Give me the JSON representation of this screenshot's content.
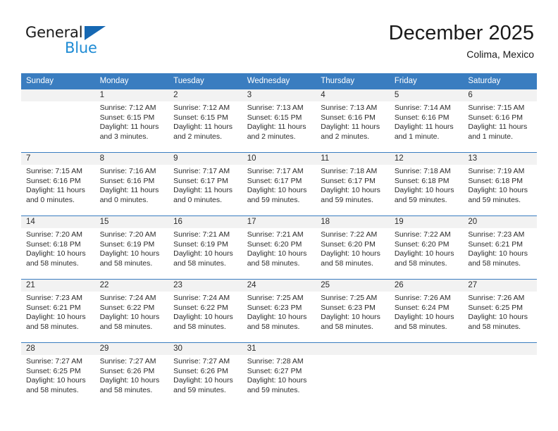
{
  "brand": {
    "name_part1": "General",
    "name_part2": "Blue",
    "triangle_color": "#1668b3",
    "blue_color": "#1e8bd4"
  },
  "header": {
    "title": "December 2025",
    "subtitle": "Colima, Mexico"
  },
  "theme": {
    "header_bar_color": "#3a7dc0",
    "daynum_bg": "#f2f2f2",
    "text_color": "#2b2b2b"
  },
  "weekdays": [
    "Sunday",
    "Monday",
    "Tuesday",
    "Wednesday",
    "Thursday",
    "Friday",
    "Saturday"
  ],
  "weeks": [
    [
      {
        "day": "",
        "sunrise": "",
        "sunset": "",
        "daylight": "",
        "empty": true
      },
      {
        "day": "1",
        "sunrise": "Sunrise: 7:12 AM",
        "sunset": "Sunset: 6:15 PM",
        "daylight": "Daylight: 11 hours and 3 minutes."
      },
      {
        "day": "2",
        "sunrise": "Sunrise: 7:12 AM",
        "sunset": "Sunset: 6:15 PM",
        "daylight": "Daylight: 11 hours and 2 minutes."
      },
      {
        "day": "3",
        "sunrise": "Sunrise: 7:13 AM",
        "sunset": "Sunset: 6:15 PM",
        "daylight": "Daylight: 11 hours and 2 minutes."
      },
      {
        "day": "4",
        "sunrise": "Sunrise: 7:13 AM",
        "sunset": "Sunset: 6:16 PM",
        "daylight": "Daylight: 11 hours and 2 minutes."
      },
      {
        "day": "5",
        "sunrise": "Sunrise: 7:14 AM",
        "sunset": "Sunset: 6:16 PM",
        "daylight": "Daylight: 11 hours and 1 minute."
      },
      {
        "day": "6",
        "sunrise": "Sunrise: 7:15 AM",
        "sunset": "Sunset: 6:16 PM",
        "daylight": "Daylight: 11 hours and 1 minute."
      }
    ],
    [
      {
        "day": "7",
        "sunrise": "Sunrise: 7:15 AM",
        "sunset": "Sunset: 6:16 PM",
        "daylight": "Daylight: 11 hours and 0 minutes."
      },
      {
        "day": "8",
        "sunrise": "Sunrise: 7:16 AM",
        "sunset": "Sunset: 6:16 PM",
        "daylight": "Daylight: 11 hours and 0 minutes."
      },
      {
        "day": "9",
        "sunrise": "Sunrise: 7:17 AM",
        "sunset": "Sunset: 6:17 PM",
        "daylight": "Daylight: 11 hours and 0 minutes."
      },
      {
        "day": "10",
        "sunrise": "Sunrise: 7:17 AM",
        "sunset": "Sunset: 6:17 PM",
        "daylight": "Daylight: 10 hours and 59 minutes."
      },
      {
        "day": "11",
        "sunrise": "Sunrise: 7:18 AM",
        "sunset": "Sunset: 6:17 PM",
        "daylight": "Daylight: 10 hours and 59 minutes."
      },
      {
        "day": "12",
        "sunrise": "Sunrise: 7:18 AM",
        "sunset": "Sunset: 6:18 PM",
        "daylight": "Daylight: 10 hours and 59 minutes."
      },
      {
        "day": "13",
        "sunrise": "Sunrise: 7:19 AM",
        "sunset": "Sunset: 6:18 PM",
        "daylight": "Daylight: 10 hours and 59 minutes."
      }
    ],
    [
      {
        "day": "14",
        "sunrise": "Sunrise: 7:20 AM",
        "sunset": "Sunset: 6:18 PM",
        "daylight": "Daylight: 10 hours and 58 minutes."
      },
      {
        "day": "15",
        "sunrise": "Sunrise: 7:20 AM",
        "sunset": "Sunset: 6:19 PM",
        "daylight": "Daylight: 10 hours and 58 minutes."
      },
      {
        "day": "16",
        "sunrise": "Sunrise: 7:21 AM",
        "sunset": "Sunset: 6:19 PM",
        "daylight": "Daylight: 10 hours and 58 minutes."
      },
      {
        "day": "17",
        "sunrise": "Sunrise: 7:21 AM",
        "sunset": "Sunset: 6:20 PM",
        "daylight": "Daylight: 10 hours and 58 minutes."
      },
      {
        "day": "18",
        "sunrise": "Sunrise: 7:22 AM",
        "sunset": "Sunset: 6:20 PM",
        "daylight": "Daylight: 10 hours and 58 minutes."
      },
      {
        "day": "19",
        "sunrise": "Sunrise: 7:22 AM",
        "sunset": "Sunset: 6:20 PM",
        "daylight": "Daylight: 10 hours and 58 minutes."
      },
      {
        "day": "20",
        "sunrise": "Sunrise: 7:23 AM",
        "sunset": "Sunset: 6:21 PM",
        "daylight": "Daylight: 10 hours and 58 minutes."
      }
    ],
    [
      {
        "day": "21",
        "sunrise": "Sunrise: 7:23 AM",
        "sunset": "Sunset: 6:21 PM",
        "daylight": "Daylight: 10 hours and 58 minutes."
      },
      {
        "day": "22",
        "sunrise": "Sunrise: 7:24 AM",
        "sunset": "Sunset: 6:22 PM",
        "daylight": "Daylight: 10 hours and 58 minutes."
      },
      {
        "day": "23",
        "sunrise": "Sunrise: 7:24 AM",
        "sunset": "Sunset: 6:22 PM",
        "daylight": "Daylight: 10 hours and 58 minutes."
      },
      {
        "day": "24",
        "sunrise": "Sunrise: 7:25 AM",
        "sunset": "Sunset: 6:23 PM",
        "daylight": "Daylight: 10 hours and 58 minutes."
      },
      {
        "day": "25",
        "sunrise": "Sunrise: 7:25 AM",
        "sunset": "Sunset: 6:23 PM",
        "daylight": "Daylight: 10 hours and 58 minutes."
      },
      {
        "day": "26",
        "sunrise": "Sunrise: 7:26 AM",
        "sunset": "Sunset: 6:24 PM",
        "daylight": "Daylight: 10 hours and 58 minutes."
      },
      {
        "day": "27",
        "sunrise": "Sunrise: 7:26 AM",
        "sunset": "Sunset: 6:25 PM",
        "daylight": "Daylight: 10 hours and 58 minutes."
      }
    ],
    [
      {
        "day": "28",
        "sunrise": "Sunrise: 7:27 AM",
        "sunset": "Sunset: 6:25 PM",
        "daylight": "Daylight: 10 hours and 58 minutes."
      },
      {
        "day": "29",
        "sunrise": "Sunrise: 7:27 AM",
        "sunset": "Sunset: 6:26 PM",
        "daylight": "Daylight: 10 hours and 58 minutes."
      },
      {
        "day": "30",
        "sunrise": "Sunrise: 7:27 AM",
        "sunset": "Sunset: 6:26 PM",
        "daylight": "Daylight: 10 hours and 59 minutes."
      },
      {
        "day": "31",
        "sunrise": "Sunrise: 7:28 AM",
        "sunset": "Sunset: 6:27 PM",
        "daylight": "Daylight: 10 hours and 59 minutes."
      },
      {
        "day": "",
        "sunrise": "",
        "sunset": "",
        "daylight": "",
        "empty": true
      },
      {
        "day": "",
        "sunrise": "",
        "sunset": "",
        "daylight": "",
        "empty": true
      },
      {
        "day": "",
        "sunrise": "",
        "sunset": "",
        "daylight": "",
        "empty": true
      }
    ]
  ]
}
